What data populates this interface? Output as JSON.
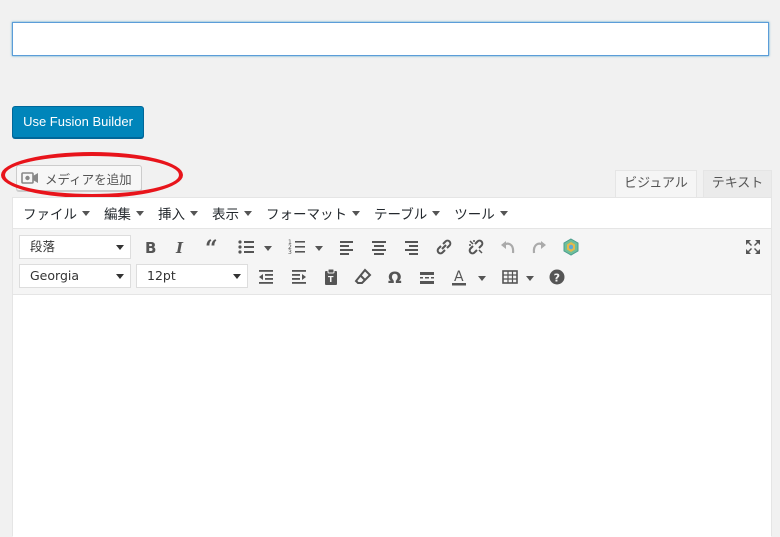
{
  "title_field": {
    "value": "",
    "placeholder": ""
  },
  "fusion_builder": {
    "label": "Use Fusion Builder"
  },
  "media": {
    "label": "メディアを追加"
  },
  "tabs": {
    "visual": "ビジュアル",
    "text": "テキスト"
  },
  "menubar": [
    "ファイル",
    "編集",
    "挿入",
    "表示",
    "フォーマット",
    "テーブル",
    "ツール"
  ],
  "toolbar": {
    "format_select": "段落",
    "font_select": "Georgia",
    "size_select": "12pt"
  },
  "colors": {
    "accent": "#0085ba",
    "highlight": "#e8141b"
  }
}
